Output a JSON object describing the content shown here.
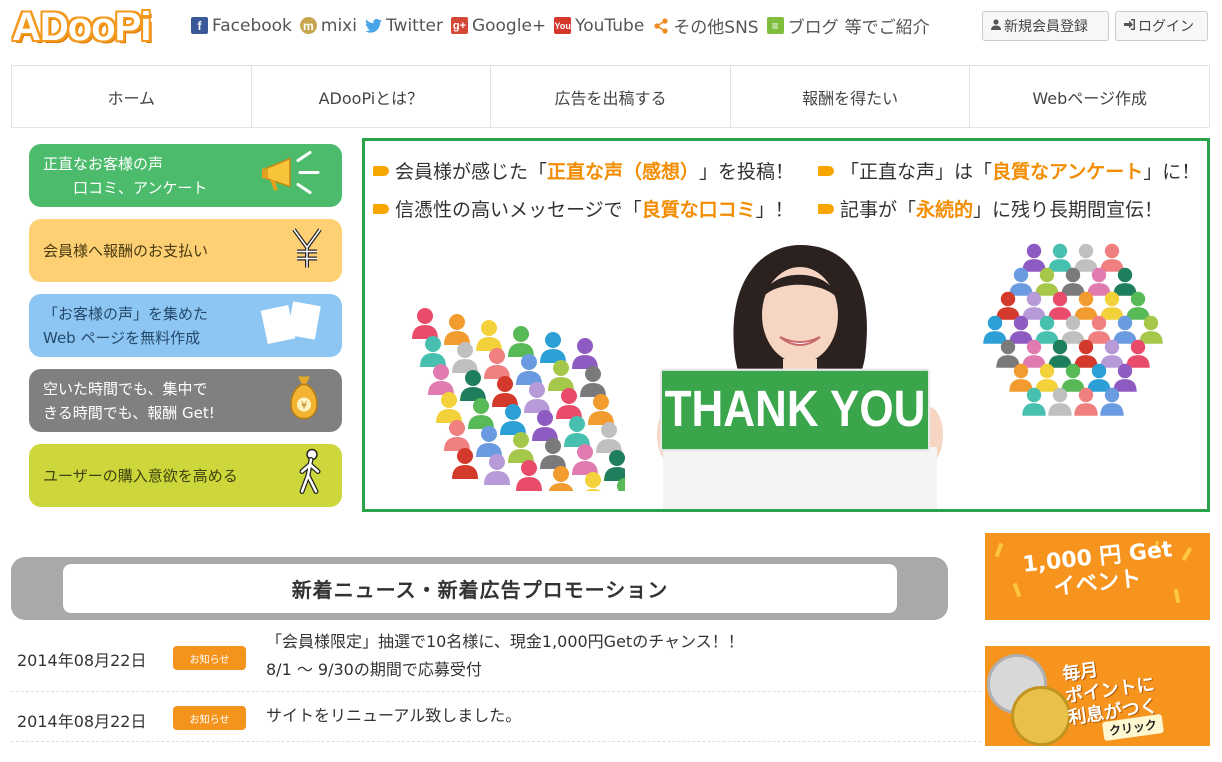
{
  "header": {
    "logo": "ADooPi",
    "social": [
      {
        "icon": "facebook-icon",
        "glyph": "f",
        "label": "Facebook"
      },
      {
        "icon": "mixi-icon",
        "glyph": "m",
        "label": "mixi"
      },
      {
        "icon": "twitter-icon",
        "glyph": "🐦",
        "label": "Twitter"
      },
      {
        "icon": "google-plus-icon",
        "glyph": "g+",
        "label": "Google+"
      },
      {
        "icon": "youtube-icon",
        "glyph": "You",
        "label": "YouTube"
      },
      {
        "icon": "share-icon",
        "glyph": "⋖",
        "label": "その他SNS"
      },
      {
        "icon": "blog-icon",
        "glyph": "≡",
        "label": "ブログ"
      }
    ],
    "social_suffix": "等でご紹介",
    "register_label": "新規会員登録",
    "login_label": "ログイン"
  },
  "nav": {
    "items": [
      "ホーム",
      "ADooPiとは？",
      "広告を出稿する",
      "報酬を得たい",
      "Webページ作成"
    ]
  },
  "side_menu": [
    {
      "label": "正直なお客様の声\n　　口コミ、アンケート",
      "icon": "megaphone-icon"
    },
    {
      "label": "会員様へ報酬のお支払い",
      "icon": "yen-icon"
    },
    {
      "label": "「お客様の声」を集めた\nWeb ページを無料作成",
      "icon": "documents-icon"
    },
    {
      "label": "空いた時間でも、集中で\nきる時間でも、報酬 Get!",
      "icon": "money-bag-icon"
    },
    {
      "label": "ユーザーの購入意欲を高める",
      "icon": "walking-person-icon"
    }
  ],
  "banner": {
    "line1a": {
      "pre": "会員様が感じた「",
      "hl": "正直な声（感想）",
      "post": "」を投稿！"
    },
    "line1b": {
      "pre": "「正直な声」は「",
      "hl": "良質なアンケート",
      "post": "」に！"
    },
    "line2a": {
      "pre": "信憑性の高いメッセージで「",
      "hl": "良質な口コミ",
      "post": "」！"
    },
    "line2b": {
      "pre": "記事が「",
      "hl": "永続的",
      "post": "」に残り長期間宣伝！"
    },
    "sign": "THANK YOU"
  },
  "news": {
    "heading": "新着ニュース・新着広告プロモーション",
    "items": [
      {
        "date": "2014年08月22日",
        "badge": "お知らせ",
        "line1": "「会員様限定」抽選で10名様に、現金1,000円Getのチャンス！！",
        "line2": "8/1 ～ 9/30の期間で応募受付"
      },
      {
        "date": "2014年08月22日",
        "badge": "お知らせ",
        "line1": "サイトをリニューアル致しました。",
        "line2": ""
      }
    ]
  },
  "right_banners": {
    "event_line1": "1,000 円 Get",
    "event_line2": "イベント",
    "points_line1": "毎月",
    "points_line2": "ポイントに",
    "points_line3": "利息がつく",
    "points_click": "クリック"
  },
  "colors": {
    "brand_orange": "#f39a1e",
    "banner_border": "#2ba24c",
    "badge": "#f4941c"
  }
}
